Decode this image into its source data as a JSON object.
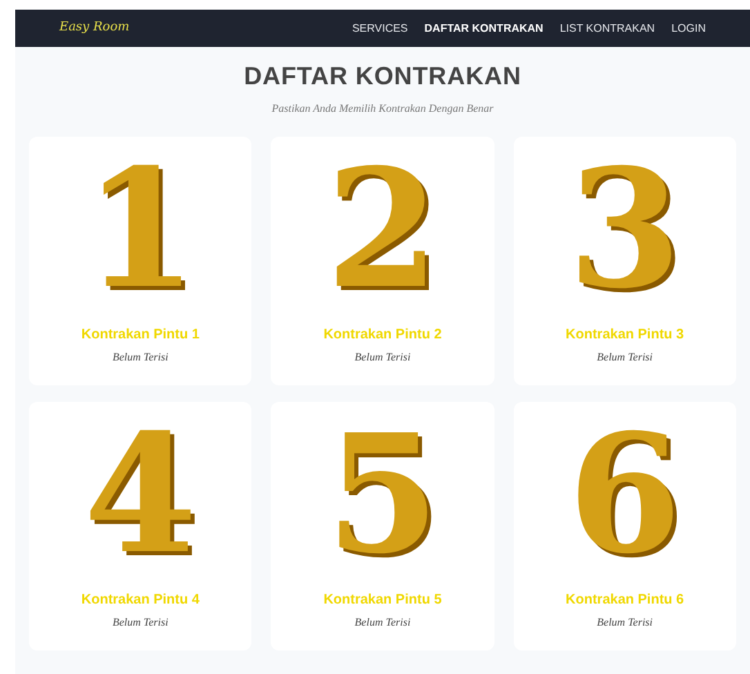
{
  "navbar": {
    "brand": "Easy Room",
    "links": [
      {
        "label": "SERVICES",
        "selected": false
      },
      {
        "label": "DAFTAR KONTRAKAN",
        "selected": true
      },
      {
        "label": "LIST KONTRAKAN",
        "selected": false
      },
      {
        "label": "LOGIN",
        "selected": false
      }
    ]
  },
  "heading": {
    "title": "DAFTAR KONTRAKAN",
    "subtitle": "Pastikan Anda Memilih Kontrakan Dengan Benar"
  },
  "cards": [
    {
      "number": "1",
      "name": "Kontrakan Pintu 1",
      "status": "Belum Terisi"
    },
    {
      "number": "2",
      "name": "Kontrakan Pintu 2",
      "status": "Belum Terisi"
    },
    {
      "number": "3",
      "name": "Kontrakan Pintu 3",
      "status": "Belum Terisi"
    },
    {
      "number": "4",
      "name": "Kontrakan Pintu 4",
      "status": "Belum Terisi"
    },
    {
      "number": "5",
      "name": "Kontrakan Pintu 5",
      "status": "Belum Terisi"
    },
    {
      "number": "6",
      "name": "Kontrakan Pintu 6",
      "status": "Belum Terisi"
    }
  ]
}
